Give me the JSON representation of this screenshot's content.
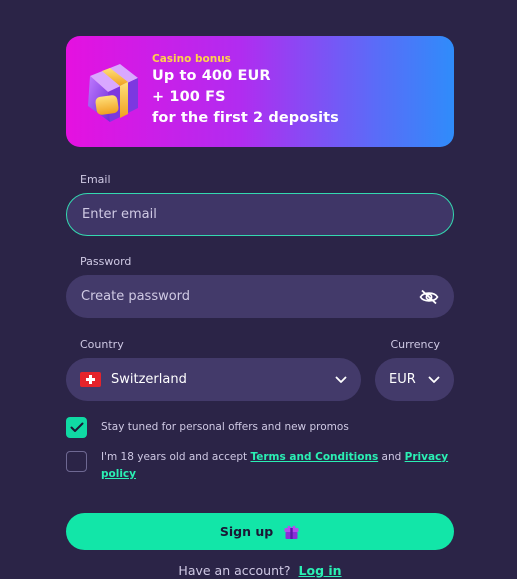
{
  "banner": {
    "kicker": "Casino bonus",
    "lines": [
      "Up to 400 EUR",
      "+ 100 FS",
      "for the first 2 deposits"
    ],
    "icon": "gift-box-icon"
  },
  "email": {
    "label": "Email",
    "placeholder": "Enter email"
  },
  "password": {
    "label": "Password",
    "placeholder": "Create password",
    "icon": "eye-off-icon"
  },
  "country": {
    "label": "Country",
    "value": "Switzerland",
    "flag": "swiss-flag-icon"
  },
  "currency": {
    "label": "Currency",
    "value": "EUR"
  },
  "consents": {
    "promos": {
      "checked": true,
      "text": "Stay tuned for personal offers and new promos"
    },
    "age": {
      "checked": false,
      "text_before": "I'm 18 years old and accept ",
      "terms_link": "Terms and Conditions",
      "text_middle": " and ",
      "privacy_link": "Privacy policy"
    }
  },
  "signup": {
    "label": "Sign up",
    "icon": "gift-icon"
  },
  "login": {
    "prompt": "Have an account?",
    "link": "Log in"
  },
  "colors": {
    "background": "#2b2447",
    "field": "#433a6a",
    "accent": "#12e6a8",
    "banner_start": "#e511e0",
    "banner_end": "#2f8cfa"
  }
}
